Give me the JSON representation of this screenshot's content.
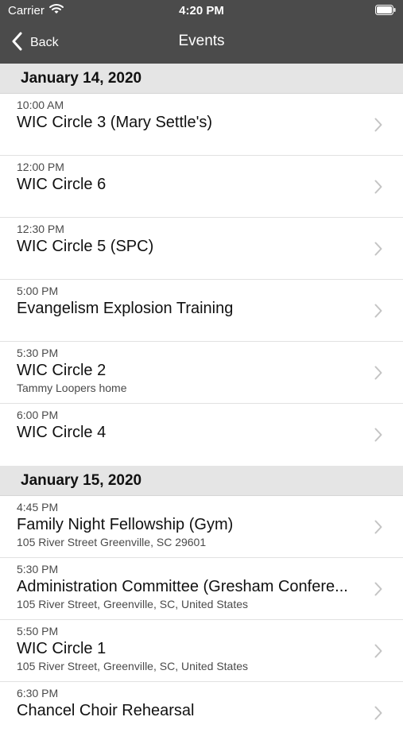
{
  "status_bar": {
    "carrier": "Carrier",
    "time": "4:20 PM"
  },
  "nav": {
    "back_label": "Back",
    "title": "Events"
  },
  "sections": [
    {
      "date": "January 14, 2020",
      "events": [
        {
          "time": "10:00 AM",
          "title": "WIC Circle 3 (Mary Settle's)",
          "subtitle": ""
        },
        {
          "time": "12:00 PM",
          "title": "WIC Circle 6",
          "subtitle": ""
        },
        {
          "time": "12:30 PM",
          "title": "WIC Circle 5 (SPC)",
          "subtitle": ""
        },
        {
          "time": "5:00 PM",
          "title": "Evangelism Explosion Training",
          "subtitle": ""
        },
        {
          "time": "5:30 PM",
          "title": "WIC Circle 2",
          "subtitle": "Tammy Loopers home"
        },
        {
          "time": "6:00 PM",
          "title": "WIC Circle 4",
          "subtitle": ""
        }
      ]
    },
    {
      "date": "January 15, 2020",
      "events": [
        {
          "time": "4:45 PM",
          "title": "Family Night Fellowship (Gym)",
          "subtitle": "105 River Street Greenville, SC 29601"
        },
        {
          "time": "5:30 PM",
          "title": "Administration Committee (Gresham Confere...",
          "subtitle": "105 River Street, Greenville, SC, United States"
        },
        {
          "time": "5:50 PM",
          "title": "WIC Circle 1",
          "subtitle": "105 River Street, Greenville, SC, United States"
        },
        {
          "time": "6:30 PM",
          "title": "Chancel Choir Rehearsal",
          "subtitle": ""
        }
      ]
    }
  ],
  "colors": {
    "nav_bg": "#4b4b4b",
    "section_bg": "#e5e5e5",
    "chevron": "#c4c4c4"
  }
}
